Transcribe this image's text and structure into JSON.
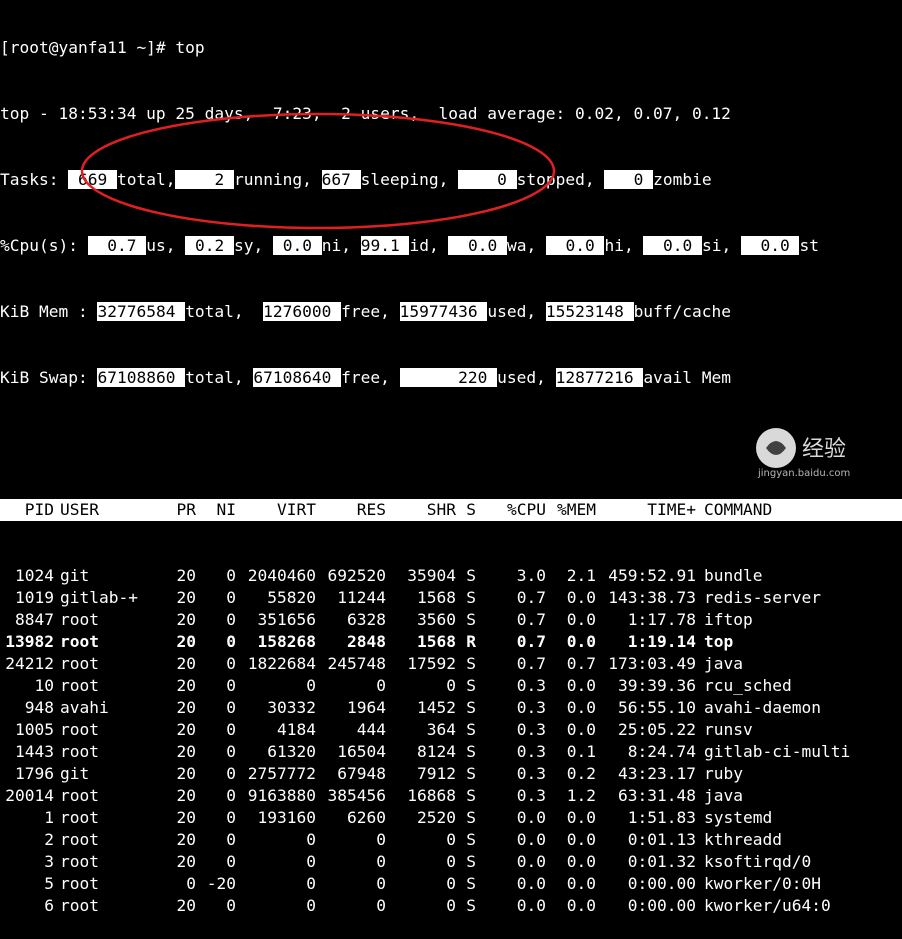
{
  "prompt": "[root@yanfa11 ~]# top",
  "summary": {
    "uptime_line": "top - 18:53:34 up 25 days,  7:23,  2 users,  load average: 0.02, 0.07, 0.12",
    "tasks": {
      "label": "Tasks:",
      "total": "669",
      "total_l": "total,",
      "running": "2",
      "running_l": "running,",
      "sleeping": "667",
      "sleeping_l": "sleeping,",
      "stopped": "0",
      "stopped_l": "stopped,",
      "zombie": "0",
      "zombie_l": "zombie"
    },
    "cpu": {
      "label": "%Cpu(s):",
      "us": "0.7",
      "us_l": "us,",
      "sy": "0.2",
      "sy_l": "sy,",
      "ni": "0.0",
      "ni_l": "ni,",
      "id": "99.1",
      "id_l": "id,",
      "wa": "0.0",
      "wa_l": "wa,",
      "hi": "0.0",
      "hi_l": "hi,",
      "si": "0.0",
      "si_l": "si,",
      "st": "0.0",
      "st_l": "st"
    },
    "mem": {
      "label": "KiB Mem :",
      "total": "32776584",
      "total_l": "total,",
      "free": "1276000",
      "free_l": "free,",
      "used": "15977436",
      "used_l": "used,",
      "buff": "15523148",
      "buff_l": "buff/cache"
    },
    "swap": {
      "label": "KiB Swap:",
      "total": "67108860",
      "total_l": "total,",
      "free": "67108640",
      "free_l": "free,",
      "used": "220",
      "used_l": "used,",
      "avail": "12877216",
      "avail_l": "avail Mem"
    }
  },
  "columns": [
    "PID",
    "USER",
    "PR",
    "NI",
    "VIRT",
    "RES",
    "SHR",
    "S",
    "%CPU",
    "%MEM",
    "TIME+",
    "COMMAND"
  ],
  "rows": [
    [
      "1024",
      "git",
      "20",
      "0",
      "2040460",
      "692520",
      "35904",
      "S",
      "3.0",
      "2.1",
      "459:52.91",
      "bundle"
    ],
    [
      "1019",
      "gitlab-+",
      "20",
      "0",
      "55820",
      "11244",
      "1568",
      "S",
      "0.7",
      "0.0",
      "143:38.73",
      "redis-server"
    ],
    [
      "8847",
      "root",
      "20",
      "0",
      "351656",
      "6328",
      "3560",
      "S",
      "0.7",
      "0.0",
      "1:17.78",
      "iftop"
    ],
    [
      "13982",
      "root",
      "20",
      "0",
      "158268",
      "2848",
      "1568",
      "R",
      "0.7",
      "0.0",
      "1:19.14",
      "top"
    ],
    [
      "24212",
      "root",
      "20",
      "0",
      "1822684",
      "245748",
      "17592",
      "S",
      "0.7",
      "0.7",
      "173:03.49",
      "java"
    ],
    [
      "10",
      "root",
      "20",
      "0",
      "0",
      "0",
      "0",
      "S",
      "0.3",
      "0.0",
      "39:39.36",
      "rcu_sched"
    ],
    [
      "948",
      "avahi",
      "20",
      "0",
      "30332",
      "1964",
      "1452",
      "S",
      "0.3",
      "0.0",
      "56:55.10",
      "avahi-daemon"
    ],
    [
      "1005",
      "root",
      "20",
      "0",
      "4184",
      "444",
      "364",
      "S",
      "0.3",
      "0.0",
      "25:05.22",
      "runsv"
    ],
    [
      "1443",
      "root",
      "20",
      "0",
      "61320",
      "16504",
      "8124",
      "S",
      "0.3",
      "0.1",
      "8:24.74",
      "gitlab-ci-multi"
    ],
    [
      "1796",
      "git",
      "20",
      "0",
      "2757772",
      "67948",
      "7912",
      "S",
      "0.3",
      "0.2",
      "43:23.17",
      "ruby"
    ],
    [
      "20014",
      "root",
      "20",
      "0",
      "9163880",
      "385456",
      "16868",
      "S",
      "0.3",
      "1.2",
      "63:31.48",
      "java"
    ],
    [
      "1",
      "root",
      "20",
      "0",
      "193160",
      "6260",
      "2520",
      "S",
      "0.0",
      "0.0",
      "1:51.83",
      "systemd"
    ],
    [
      "2",
      "root",
      "20",
      "0",
      "0",
      "0",
      "0",
      "S",
      "0.0",
      "0.0",
      "0:01.13",
      "kthreadd"
    ],
    [
      "3",
      "root",
      "20",
      "0",
      "0",
      "0",
      "0",
      "S",
      "0.0",
      "0.0",
      "0:01.32",
      "ksoftirqd/0"
    ],
    [
      "5",
      "root",
      "0",
      "-20",
      "0",
      "0",
      "0",
      "S",
      "0.0",
      "0.0",
      "0:00.00",
      "kworker/0:0H"
    ],
    [
      "6",
      "root",
      "20",
      "0",
      "0",
      "0",
      "0",
      "S",
      "0.0",
      "0.0",
      "0:00.00",
      "kworker/u64:0"
    ]
  ],
  "highlight_row_index": 3,
  "watermark": {
    "text": "经验",
    "sub": "jingyan.baidu.com"
  },
  "colors": {
    "bg": "#000000",
    "fg": "#ffffff",
    "annotation": "#e02020"
  }
}
